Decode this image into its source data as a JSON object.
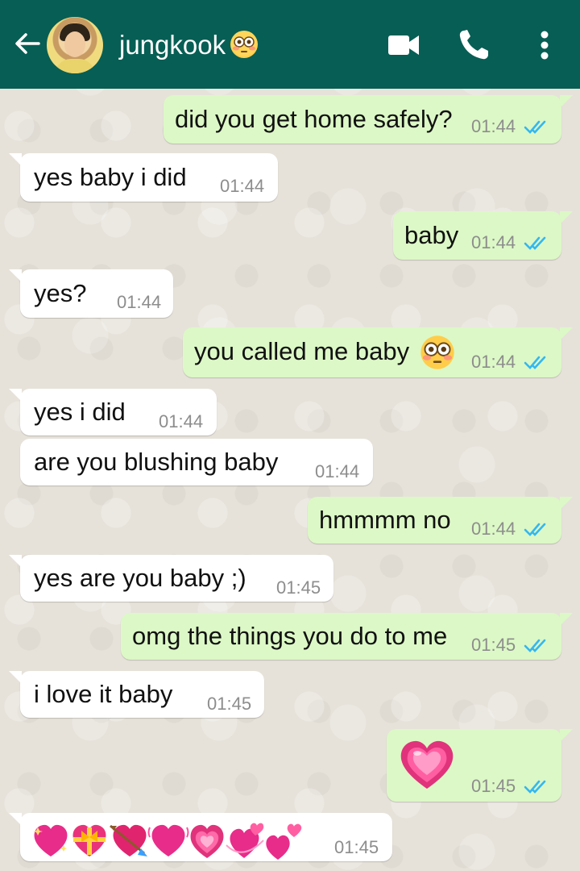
{
  "header": {
    "contact_name": "jungkook",
    "title_emoji": "flushed-face",
    "icons": [
      "back-arrow-icon",
      "video-call-icon",
      "phone-icon",
      "more-vertical-icon"
    ]
  },
  "colors": {
    "header": "#075e54",
    "incoming_bubble": "#ffffff",
    "outgoing_bubble": "#dcf8c6",
    "read_ticks": "#34b7f1"
  },
  "messages": [
    {
      "dir": "out",
      "text": "did you get home safely?",
      "time": "01:44",
      "read": true
    },
    {
      "dir": "in",
      "text": "yes baby i did",
      "time": "01:44"
    },
    {
      "dir": "out",
      "text": "baby",
      "time": "01:44",
      "read": true
    },
    {
      "dir": "in",
      "text": "yes?",
      "time": "01:44"
    },
    {
      "dir": "out",
      "text": "you called me baby",
      "emoji": "flushed-face",
      "time": "01:44",
      "read": true
    },
    {
      "dir": "in",
      "text": "yes i did",
      "time": "01:44"
    },
    {
      "dir": "in",
      "text": "are you blushing baby",
      "time": "01:44"
    },
    {
      "dir": "out",
      "text": "hmmmm no",
      "time": "01:44",
      "read": true
    },
    {
      "dir": "in",
      "text": "yes are you baby ;)",
      "time": "01:45"
    },
    {
      "dir": "out",
      "text": "omg the things you do to me",
      "time": "01:45",
      "read": true
    },
    {
      "dir": "in",
      "text": "i love it baby",
      "time": "01:45"
    },
    {
      "dir": "out",
      "emoji": "growing-heart",
      "time": "01:45",
      "read": true
    },
    {
      "dir": "in",
      "emoji_sequence": [
        "sparkling-heart",
        "heart-with-ribbon",
        "heart-with-arrow",
        "beating-heart",
        "growing-heart",
        "revolving-hearts",
        "two-hearts"
      ],
      "time": "01:45"
    }
  ]
}
